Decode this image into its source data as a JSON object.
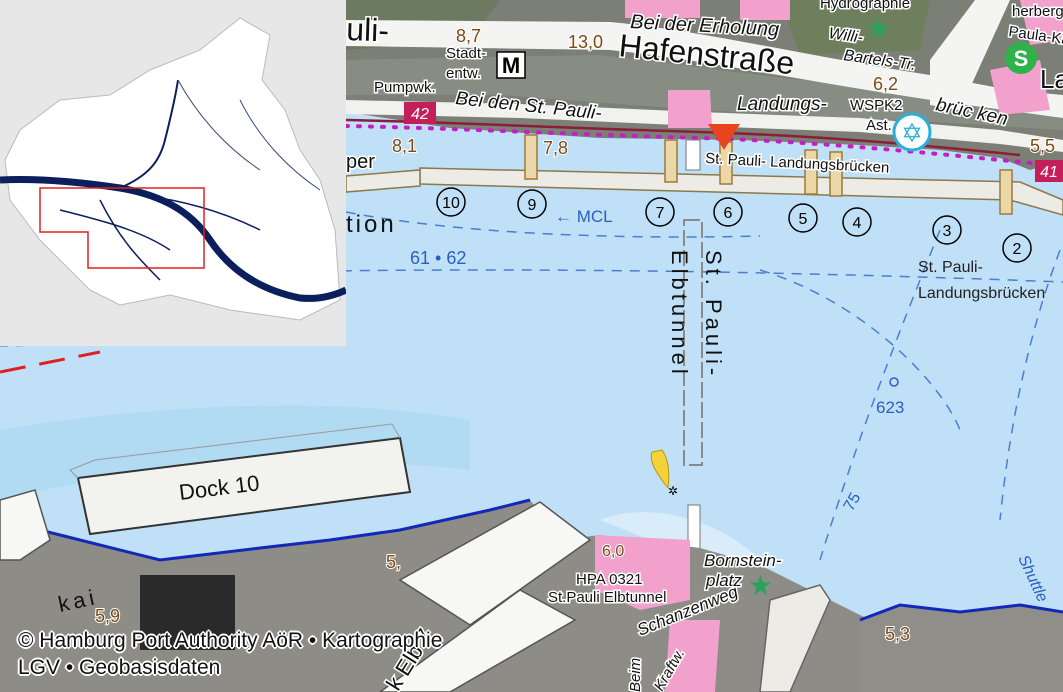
{
  "map": {
    "street_labels": {
      "hafenstrasse": "Hafenstraße",
      "pauli_left": "uli-",
      "bei_der_erholung": "Bei der Erholung",
      "bei_den_st_pauli": "Bei den St. Pauli-",
      "landungs": "Landungs-",
      "brucken": "brüc ken",
      "willi": "Willi-",
      "bartels": "Bartels-Tr.",
      "hydrographie": "Hydrographie",
      "herberge": "herberg",
      "paula": "Paula-Ka",
      "la": "La",
      "pumpwk": "Pumpwk.",
      "stadt": "Stadt-",
      "entw": "entw.",
      "wspk2": "WSPK2",
      "ast": "Ast.",
      "st_pauli_landungsbrucken_pier": "St. Pauli- Landungsbrücken",
      "st_pauli_landungsbrucken_water_1": "St. Pauli-",
      "st_pauli_landungsbrucken_water_2": "Landungsbrücken",
      "st_pauli_tunnel": "St. Pauli-",
      "elbtunnel": "Elbtunnel",
      "dock10": "Dock 10",
      "hpa0321": "HPA 0321",
      "st_pauli_elbtunnel": "St.Pauli Elbtunnel",
      "bornstein": "Bornstein-",
      "platz": "platz",
      "schanzenweg": "Schanzenweg",
      "beim": "Beim",
      "kraftw": "Kraftw.",
      "kai": "kai",
      "elbe_partial": "k Elb 7",
      "shuttle": "Shuttle",
      "tion": "tion",
      "per": "per",
      "mcl": "← MCL",
      "lane_61_62": "61 • 62",
      "buoy_623": "623",
      "depth_75": "75",
      "route_42": "42",
      "route_41": "41",
      "metro": "M",
      "sbahn": "S"
    },
    "heights": {
      "h87": "8,7",
      "h130": "13,0",
      "h62": "6,2",
      "h55": "5,5",
      "h81": "8,1",
      "h78": "7,8",
      "h59": "5,9",
      "h53": "5,3",
      "h5": "5,",
      "h60": "6,0"
    },
    "berth_numbers": [
      "10",
      "9",
      "7",
      "6",
      "5",
      "4",
      "3",
      "2"
    ],
    "copyright_line1": "© Hamburg Port Authority AöR • Kartographie",
    "copyright_line2": "LGV • Geobasisdaten"
  },
  "colors": {
    "water": "#bfe0f6",
    "water_light": "#d8ecf9",
    "pier": "#ecebe6",
    "building_pink": "#f2a1cd",
    "route_magenta": "#c41fc4",
    "boundary_red": "#e02020",
    "overview_bg": "#e7e7e7",
    "river_dark": "#0b1f5c"
  }
}
